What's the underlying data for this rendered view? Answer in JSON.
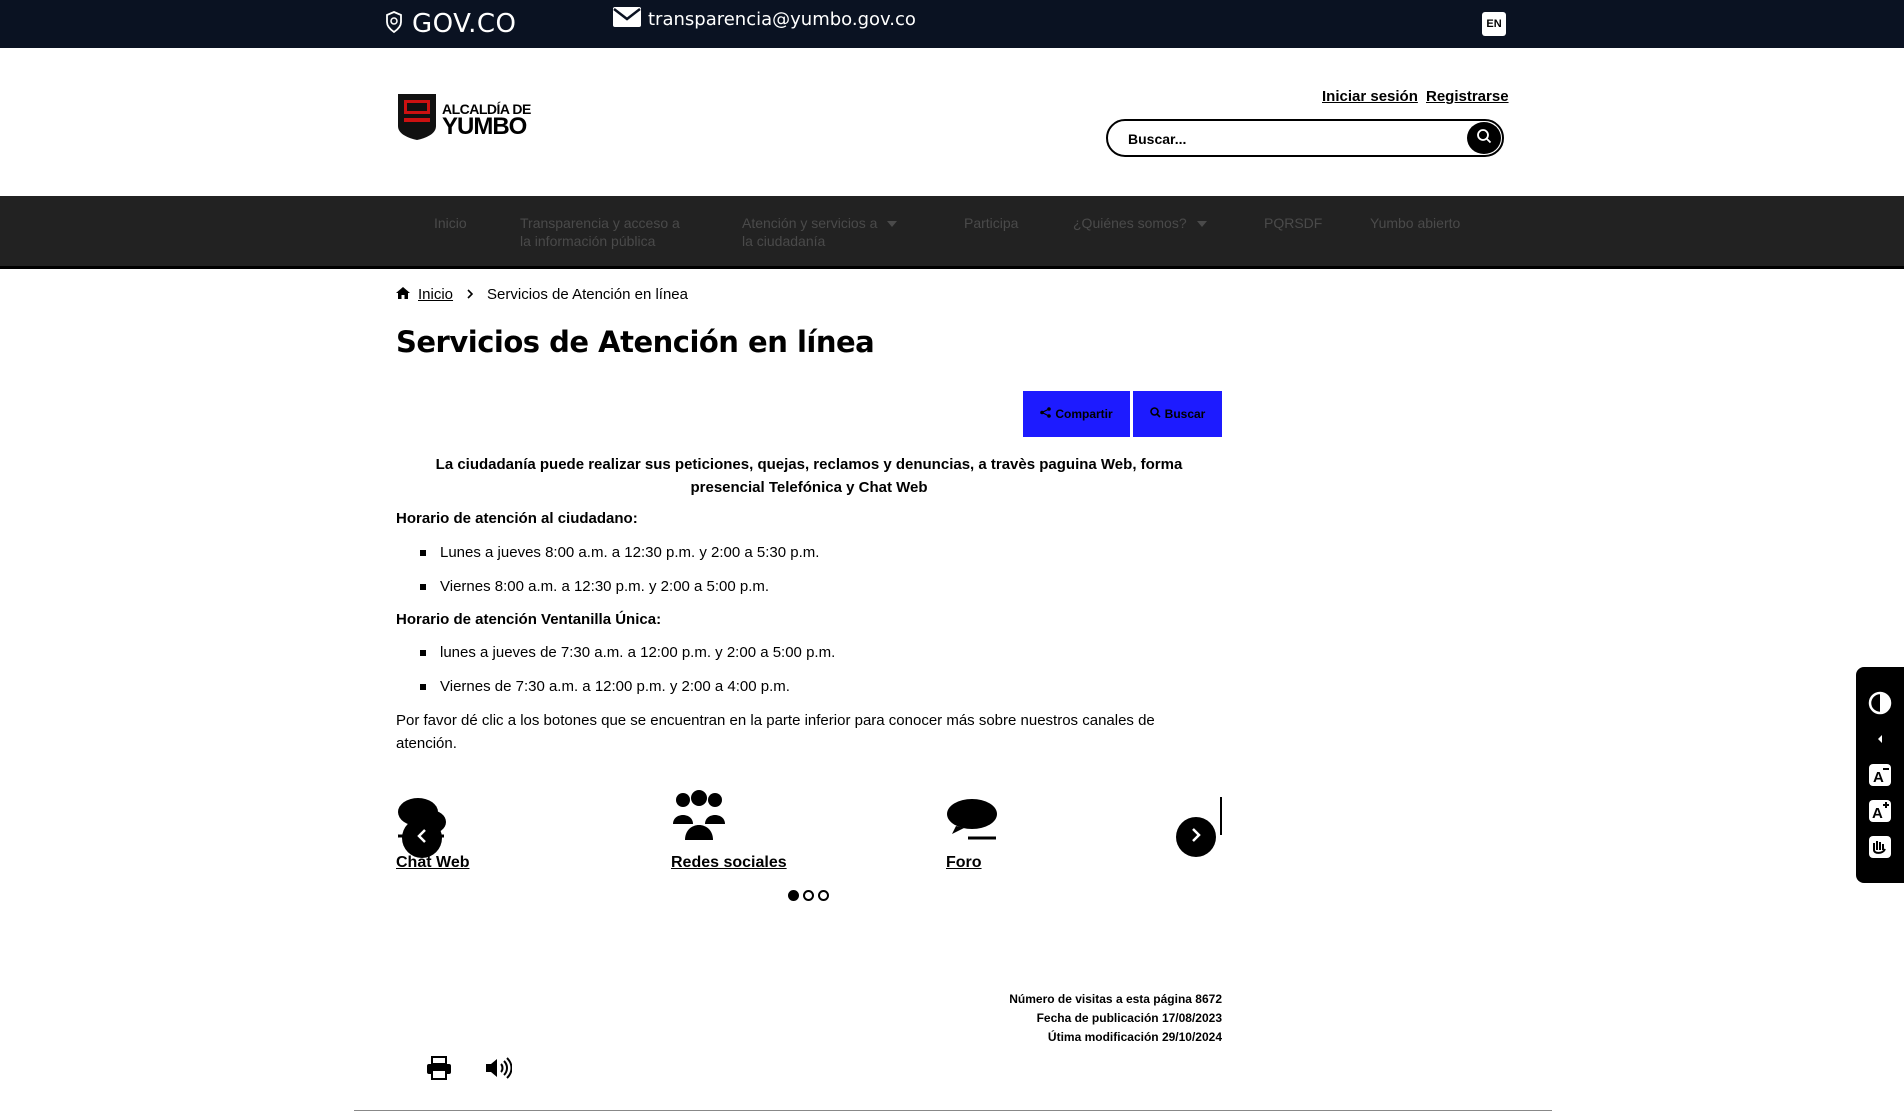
{
  "topbar": {
    "gov_logo": "GOV.CO",
    "email": "transparencia@yumbo.gov.co",
    "lang": "EN"
  },
  "header": {
    "logo_line1": "ALCALDÍA DE",
    "logo_line2": "YUMBO",
    "login": "Iniciar sesión",
    "register": "Registrarse",
    "search_placeholder": "Buscar..."
  },
  "nav": {
    "items": [
      {
        "label": "Inicio"
      },
      {
        "label": "Transparencia y acceso a",
        "label2": "la información pública"
      },
      {
        "label": "Atención y servicios a",
        "label2": "la ciudadanía"
      },
      {
        "label": "Participa"
      },
      {
        "label": "¿Quiénes somos?"
      },
      {
        "label": "PQRSDF"
      },
      {
        "label": "Yumbo abierto"
      }
    ]
  },
  "breadcrumb": {
    "home": "Inicio",
    "current": "Servicios de Atención en línea"
  },
  "page": {
    "title": "Servicios de Atención en línea",
    "share_label": "Compartir",
    "search_label": "Buscar",
    "intro_line1": "La ciudadanía puede realizar sus peticiones, quejas, reclamos y denuncias, a travès paguina Web,  forma",
    "intro_line2": "presencial  Telefónica y Chat Web",
    "schedule1_title": "Horario de atención al ciudadano:",
    "schedule1_items": [
      "Lunes a jueves  8:00 a.m. a 12:30 p.m. y 2:00 a 5:30 p.m.",
      "Viernes 8:00 a.m. a 12:30 p.m. y 2:00 a 5:00 p.m."
    ],
    "schedule2_title": "Horario de atención Ventanilla Única:",
    "schedule2_items": [
      "lunes a jueves de 7:30 a.m. a 12:00 p.m. y 2:00 a 5:00 p.m.",
      " Viernes de 7:30 a.m. a 12:00 p.m. y 2:00 a 4:00 p.m."
    ],
    "note": "Por favor dé clic a los botones que se encuentran en la parte inferior para conocer más sobre nuestros canales de atención."
  },
  "carousel": {
    "items": [
      {
        "label": "Chat Web",
        "icon": "comments-icon"
      },
      {
        "label": "Redes sociales",
        "icon": "users-icon"
      },
      {
        "label": "Foro",
        "icon": "comment-icon"
      }
    ],
    "active_dot": 0,
    "dots": 3
  },
  "meta": {
    "visits": "Número de visitas a esta página 8672",
    "published": "Fecha de publicación 17/08/2023",
    "modified": "Útima modificación 29/10/2024"
  },
  "colors": {
    "topbar": "#0a1222",
    "nav": "#222222",
    "button": "#1d1bff"
  }
}
